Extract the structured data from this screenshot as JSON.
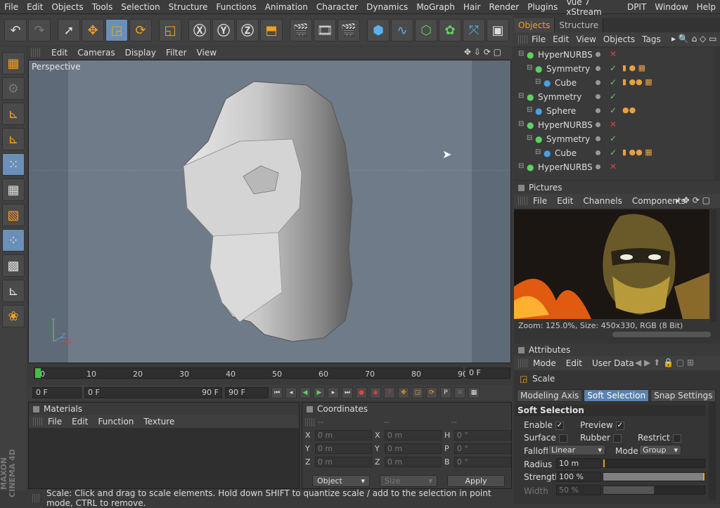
{
  "menu": [
    "File",
    "Edit",
    "Objects",
    "Tools",
    "Selection",
    "Structure",
    "Functions",
    "Animation",
    "Character",
    "Dynamics",
    "MoGraph",
    "Hair",
    "Render",
    "Plugins",
    "Vue 7 xStream",
    "DPIT",
    "Window",
    "Help"
  ],
  "viewport": {
    "menu": [
      "Edit",
      "Cameras",
      "Display",
      "Filter",
      "View"
    ],
    "label": "Perspective"
  },
  "timeline": {
    "ticks": [
      "0",
      "10",
      "20",
      "30",
      "40",
      "50",
      "60",
      "70",
      "80",
      "90"
    ],
    "current_frame": "0 F"
  },
  "transport": {
    "start": "0 F",
    "range_start": "0 F",
    "range_end": "90 F",
    "end": "90 F"
  },
  "materials": {
    "title": "Materials",
    "menu": [
      "File",
      "Edit",
      "Function",
      "Texture"
    ]
  },
  "coordinates": {
    "title": "Coordinates",
    "col_headers": [
      "--",
      "--",
      "--"
    ],
    "rows": [
      {
        "l1": "X",
        "v1": "0 m",
        "l2": "X",
        "v2": "0 m",
        "l3": "H",
        "v3": "0 °"
      },
      {
        "l1": "Y",
        "v1": "0 m",
        "l2": "Y",
        "v2": "0 m",
        "l3": "P",
        "v3": "0 °"
      },
      {
        "l1": "Z",
        "v1": "0 m",
        "l2": "Z",
        "v2": "0 m",
        "l3": "B",
        "v3": "0 °"
      }
    ],
    "mode": "Object",
    "size": "Size",
    "apply": "Apply"
  },
  "status": "Scale: Click and drag to scale elements. Hold down SHIFT to quantize scale / add to the selection in point mode, CTRL to remove.",
  "brand": "MAXON CINEMA 4D",
  "objects": {
    "tabs": [
      "Objects",
      "Structure"
    ],
    "menu": [
      "File",
      "Edit",
      "View",
      "Objects",
      "Tags"
    ],
    "items": [
      {
        "name": "HyperNURBS",
        "indent": 0,
        "state": "x",
        "color": "#5fd05f",
        "tags": ""
      },
      {
        "name": "Symmetry",
        "indent": 1,
        "state": "ok",
        "color": "#5fd05f",
        "tags": "▮ ● ▦"
      },
      {
        "name": "Cube",
        "indent": 2,
        "state": "ok",
        "color": "#4aa0e0",
        "tags": "▮ ●● ▦"
      },
      {
        "name": "Symmetry",
        "indent": 0,
        "state": "ok",
        "color": "#5fd05f",
        "tags": ""
      },
      {
        "name": "Sphere",
        "indent": 1,
        "state": "ok",
        "color": "#4aa0e0",
        "tags": "●●"
      },
      {
        "name": "HyperNURBS",
        "indent": 0,
        "state": "x",
        "color": "#5fd05f",
        "tags": ""
      },
      {
        "name": "Symmetry",
        "indent": 1,
        "state": "ok",
        "color": "#5fd05f",
        "tags": ""
      },
      {
        "name": "Cube",
        "indent": 2,
        "state": "ok",
        "color": "#4aa0e0",
        "tags": "▮ ●● ▦"
      },
      {
        "name": "HyperNURBS",
        "indent": 0,
        "state": "x",
        "color": "#5fd05f",
        "tags": ""
      }
    ]
  },
  "pictures": {
    "title": "Pictures",
    "menu": [
      "File",
      "Edit",
      "Channels",
      "Components"
    ],
    "info": "Zoom: 125.0%, Size: 450x330, RGB (8 Bit)"
  },
  "attributes": {
    "title": "Attributes",
    "menu": [
      "Mode",
      "Edit",
      "User Data"
    ],
    "tool": "Scale",
    "tabs": [
      "Modeling Axis",
      "Soft Selection",
      "Snap Settings"
    ],
    "section": "Soft Selection",
    "enable": "Enable",
    "preview": "Preview",
    "surface": "Surface",
    "rubber": "Rubber",
    "restrict": "Restrict",
    "falloff_label": "Falloff",
    "falloff": "Linear",
    "mode_label": "Mode",
    "mode": "Group",
    "radius_label": "Radius",
    "radius": "10 m",
    "strength_label": "Strength",
    "strength": "100 %",
    "strength_fraction": 1.0,
    "width_label": "Width",
    "width": "50 %",
    "width_fraction": 0.5
  },
  "icons": [
    "undo-icon",
    "redo-icon",
    "live-select-icon",
    "move-icon",
    "scale-icon",
    "rotate-icon",
    "x-axis-icon",
    "y-axis-icon",
    "z-axis-icon",
    "coordinate-system-icon",
    "render-view-icon",
    "render-picture-icon",
    "render-settings-icon",
    "cube-primitive-icon",
    "spline-icon",
    "nurbs-icon",
    "array-icon",
    "deformer-icon"
  ]
}
